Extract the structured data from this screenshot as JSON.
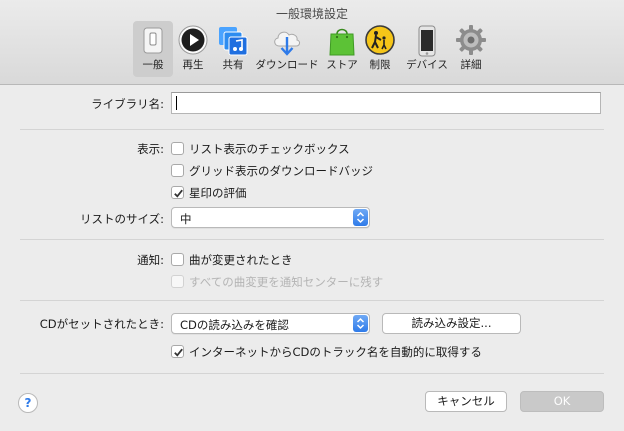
{
  "window": {
    "title": "一般環境設定"
  },
  "toolbar": {
    "items": [
      {
        "label": "一般",
        "icon": "general-switch-icon",
        "selected": true
      },
      {
        "label": "再生",
        "icon": "play-icon"
      },
      {
        "label": "共有",
        "icon": "shared-library-icon"
      },
      {
        "label": "ダウンロード",
        "icon": "cloud-download-icon"
      },
      {
        "label": "ストア",
        "icon": "shopping-bag-icon"
      },
      {
        "label": "制限",
        "icon": "parental-restrictions-icon"
      },
      {
        "label": "デバイス",
        "icon": "iphone-device-icon"
      },
      {
        "label": "詳細",
        "icon": "gear-icon"
      }
    ]
  },
  "library": {
    "label": "ライブラリ名:",
    "value": ""
  },
  "display": {
    "label": "表示:",
    "options": [
      {
        "label": "リスト表示のチェックボックス",
        "checked": false,
        "enabled": true
      },
      {
        "label": "グリッド表示のダウンロードバッジ",
        "checked": false,
        "enabled": true
      },
      {
        "label": "星印の評価",
        "checked": true,
        "enabled": true
      }
    ]
  },
  "list_size": {
    "label": "リストのサイズ:",
    "value": "中"
  },
  "notifications": {
    "label": "通知:",
    "options": [
      {
        "label": "曲が変更されたとき",
        "checked": false,
        "enabled": true
      },
      {
        "label": "すべての曲変更を通知センターに残す",
        "checked": false,
        "enabled": false
      }
    ]
  },
  "cd": {
    "label": "CDがセットされたとき:",
    "action": "CDの読み込みを確認",
    "import_settings_button": "読み込み設定...",
    "auto_track_names": {
      "label": "インターネットからCDのトラック名を自動的に取得する",
      "checked": true
    }
  },
  "footer": {
    "help": "?",
    "cancel": "キャンセル",
    "ok": "OK"
  },
  "colors": {
    "accent": "#2f7be9",
    "window_bg": "#ececec",
    "disabled_text": "#b4b4b4"
  }
}
